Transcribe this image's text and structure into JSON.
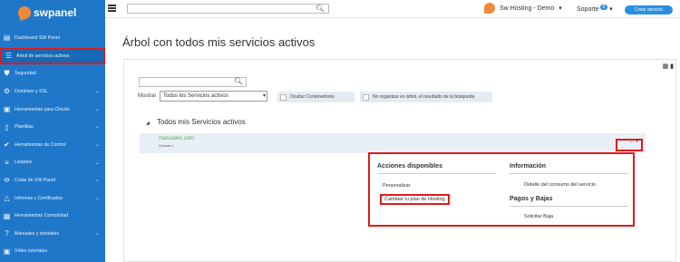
{
  "brand": {
    "name": "swpanel"
  },
  "sidebar": {
    "items": [
      {
        "label": "Dashboard SW Panel",
        "icon": "dashboard-icon",
        "chevron": false,
        "active": false
      },
      {
        "label": "Árbol de servicios activos",
        "icon": "tree-icon",
        "chevron": false,
        "active": true
      },
      {
        "label": "Seguridad",
        "icon": "shield-icon",
        "chevron": false,
        "active": false
      },
      {
        "label": "Dominios y SSL",
        "icon": "gear-icon",
        "chevron": true,
        "active": false
      },
      {
        "label": "Herramientas para Clouds",
        "icon": "briefcase-icon",
        "chevron": true,
        "active": false
      },
      {
        "label": "Plantillas",
        "icon": "document-icon",
        "chevron": true,
        "active": false
      },
      {
        "label": "Herramientas de Control",
        "icon": "check-icon",
        "chevron": true,
        "active": false
      },
      {
        "label": "Listados",
        "icon": "list-icon",
        "chevron": true,
        "active": false
      },
      {
        "label": "Colas de SW Panel",
        "icon": "layers-icon",
        "chevron": true,
        "active": false
      },
      {
        "label": "Informes y Certificados",
        "icon": "chart-icon",
        "chevron": true,
        "active": false
      },
      {
        "label": "Herramientas Comunidad",
        "icon": "toolbox-icon",
        "chevron": false,
        "active": false
      },
      {
        "label": "Manuales y tutoriales",
        "icon": "help-icon",
        "chevron": true,
        "active": false
      },
      {
        "label": "Vídeo tutoriales",
        "icon": "video-icon",
        "chevron": false,
        "active": false
      }
    ]
  },
  "topbar": {
    "search_placeholder": "",
    "account_label": "Sw Hosting - Demo",
    "support_label": "Soporte",
    "support_badge": "0",
    "create_button": "Crear servicio"
  },
  "page": {
    "title": "Árbol con todos mis servicios activos",
    "show_label": "Mostrar",
    "select_value": "Todos los Servicios activos",
    "hide_containers": "Ocultar Contenedores",
    "no_organize": "No organizar en árbol, el resultado de la búsqueda",
    "tree_title": "Todos mis Servicios activos"
  },
  "service": {
    "domain": "manuales.com",
    "plan": "Grande L",
    "menu_label": "..."
  },
  "popup": {
    "actions_header": "Acciones disponibles",
    "actions": [
      "Personalizar",
      "Cambiar tu plan de Hosting"
    ],
    "info_header": "Información",
    "info_items": [
      "Detalle del consumo del servicio"
    ],
    "billing_header": "Pagos y Bajas",
    "billing_items": [
      "Solicitar Baja"
    ]
  },
  "colors": {
    "sidebar": "#1f77c9",
    "highlight": "#e11a1a",
    "accent": "#2b8fe0",
    "logo": "#f08a3b"
  }
}
